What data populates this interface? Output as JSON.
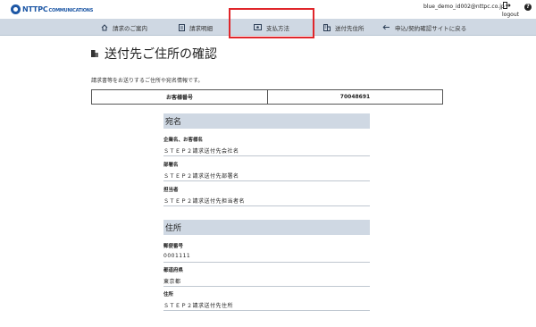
{
  "header": {
    "logo": {
      "ntt": "NTT",
      "pc": "PC",
      "communications": "COMMUNICATIONS"
    },
    "user_email": "blue_demo_id002@nttpc.co.jp",
    "logout_label": "logout",
    "help_label": "?"
  },
  "nav": {
    "items": [
      {
        "label": "請求のご案内",
        "icon": "home-icon"
      },
      {
        "label": "請求明細",
        "icon": "document-icon"
      },
      {
        "label": "支払方法",
        "icon": "payment-icon"
      },
      {
        "label": "送付先住所",
        "icon": "building-icon"
      },
      {
        "label": "申込/契約確認サイトに戻る",
        "icon": "back-arrow-icon"
      }
    ],
    "highlight_color": "#e0262b"
  },
  "page": {
    "title": "送付先ご住所の確認",
    "intro": "請求書等をお送りするご住所や宛名情報です。",
    "customer_number_label": "お客様番号",
    "customer_number_value": "70048691"
  },
  "addressee": {
    "heading": "宛名",
    "fields": [
      {
        "label": "企業名、お客様名",
        "value": "ＳＴＥＰ２請求送付先会社名"
      },
      {
        "label": "部署名",
        "value": "ＳＴＥＰ２請求送付先部署名"
      },
      {
        "label": "担当者",
        "value": "ＳＴＥＰ２請求送付先担当者名"
      }
    ]
  },
  "address": {
    "heading": "住所",
    "fields": [
      {
        "label": "郵便番号",
        "value": "0001111"
      },
      {
        "label": "都道府県",
        "value": "東京都"
      },
      {
        "label": "住所",
        "value": "ＳＴＥＰ２請求送付先住所"
      }
    ]
  },
  "colors": {
    "nav_bg": "#cfd8e3",
    "brand_blue": "#1d57a5",
    "highlight_red": "#e0262b"
  }
}
